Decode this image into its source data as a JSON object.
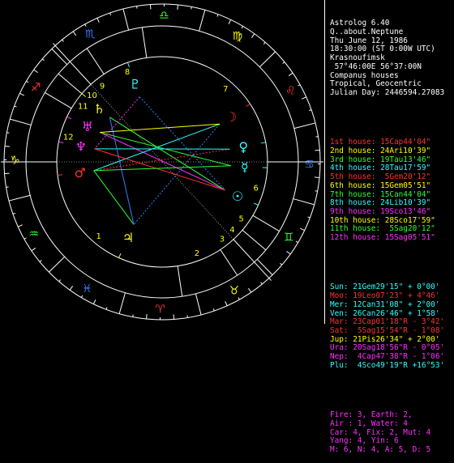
{
  "header": [
    "Astrolog 6.40",
    "Q..about.Neptune",
    "Thu June 12, 1986",
    "18:30:00 (ST 0:00W UTC)",
    "Krasnoufimsk",
    " 57°46:00E 56°37:00N",
    "Companus houses",
    "Tropical, Geocentric",
    "Julian Day: 2446594.27083"
  ],
  "houses": [
    {
      "text": "1st house: 15Cap44'04\"",
      "color": "#ff3030"
    },
    {
      "text": "2nd house: 24Ari10'39\"",
      "color": "#ffff00"
    },
    {
      "text": "3rd house: 19Tau13'46\"",
      "color": "#30ff30"
    },
    {
      "text": "4th house: 28Tau17'59\"",
      "color": "#30ffff"
    },
    {
      "text": "5th house:  5Gem20'12\"",
      "color": "#ff3030"
    },
    {
      "text": "6th house: 15Gem05'51\"",
      "color": "#ffff00"
    },
    {
      "text": "7th house: 15Can44'04\"",
      "color": "#30ff30"
    },
    {
      "text": "8th house: 24Lib10'39\"",
      "color": "#30ffff"
    },
    {
      "text": "9th house: 19Sco13'46\"",
      "color": "#ff30ff"
    },
    {
      "text": "10th house: 28Sco17'59\"",
      "color": "#ffff00"
    },
    {
      "text": "11th house:  5Sag20'12\"",
      "color": "#30ff30"
    },
    {
      "text": "12th house: 15Sag05'51\"",
      "color": "#ff30ff"
    }
  ],
  "planets": [
    {
      "name": "Sun:",
      "pos": " 21Gem29'15\"",
      "speed": " + 0°00'",
      "color": "#30ffff"
    },
    {
      "name": "Moo:",
      "pos": " 19Leo07'23\"",
      "speed": " + 4°46'",
      "color": "#ff3030"
    },
    {
      "name": "Mer:",
      "pos": " 12Can31'08\"",
      "speed": " + 2°00'",
      "color": "#30ffff"
    },
    {
      "name": "Ven:",
      "pos": " 26Can26'46\"",
      "speed": " + 1°58'",
      "color": "#30ffff"
    },
    {
      "name": "Mar:",
      "pos": " 23Cap01'18\"R",
      "speed": " - 3°42'",
      "color": "#ff3030"
    },
    {
      "name": "Sat:",
      "pos": "  5Sag15'54\"R",
      "speed": " - 1°08'",
      "color": "#ff3030"
    },
    {
      "name": "Jup:",
      "pos": " 21Pis26'34\"",
      "speed": " + 2°00'",
      "color": "#ffff00"
    },
    {
      "name": "Ura:",
      "pos": " 20Sag18'56\"R",
      "speed": " - 0°05'",
      "color": "#ff30ff"
    },
    {
      "name": "Nep:",
      "pos": "  4Cap47'38\"R",
      "speed": " - 1°06'",
      "color": "#ff30ff"
    },
    {
      "name": "Plu:",
      "pos": "  4Sco49'19\"R",
      "speed": " +16°53'",
      "color": "#30ffff"
    }
  ],
  "stats": [
    {
      "text": "Fire: 3, Earth: 2,",
      "color": "#ff30ff"
    },
    {
      "text": "Air : 1, Water: 4",
      "color": "#ff30ff"
    },
    {
      "text": "Car: 4, Fix: 2, Mut: 4",
      "color": "#ff30ff"
    },
    {
      "text": "Yang: 4, Yin: 6",
      "color": "#ff30ff"
    },
    {
      "text": "M: 6, N: 4, A: 5, D: 5",
      "color": "#ff30ff"
    }
  ],
  "wheel": {
    "sign_glyphs": [
      "♈",
      "♉",
      "♊",
      "♋",
      "♌",
      "♍",
      "♎",
      "♏",
      "♐",
      "♑",
      "♒",
      "♓"
    ],
    "house_numbers": [
      "1",
      "2",
      "3",
      "4",
      "5",
      "6",
      "7",
      "8",
      "9",
      "10",
      "11",
      "12"
    ],
    "planet_glyphs": {
      "sun": "☉",
      "moon": "☽",
      "mercury": "☿",
      "venus": "♀",
      "mars": "♂",
      "jupiter": "♃",
      "saturn": "♄",
      "uranus": "♅",
      "neptune": "♆",
      "pluto": "♇"
    },
    "colors": {
      "fire": "#ff3030",
      "earth": "#ffff00",
      "air": "#30ff30",
      "water": "#3080ff",
      "ring": "#ffffff",
      "house_line": "#ffffff"
    }
  }
}
